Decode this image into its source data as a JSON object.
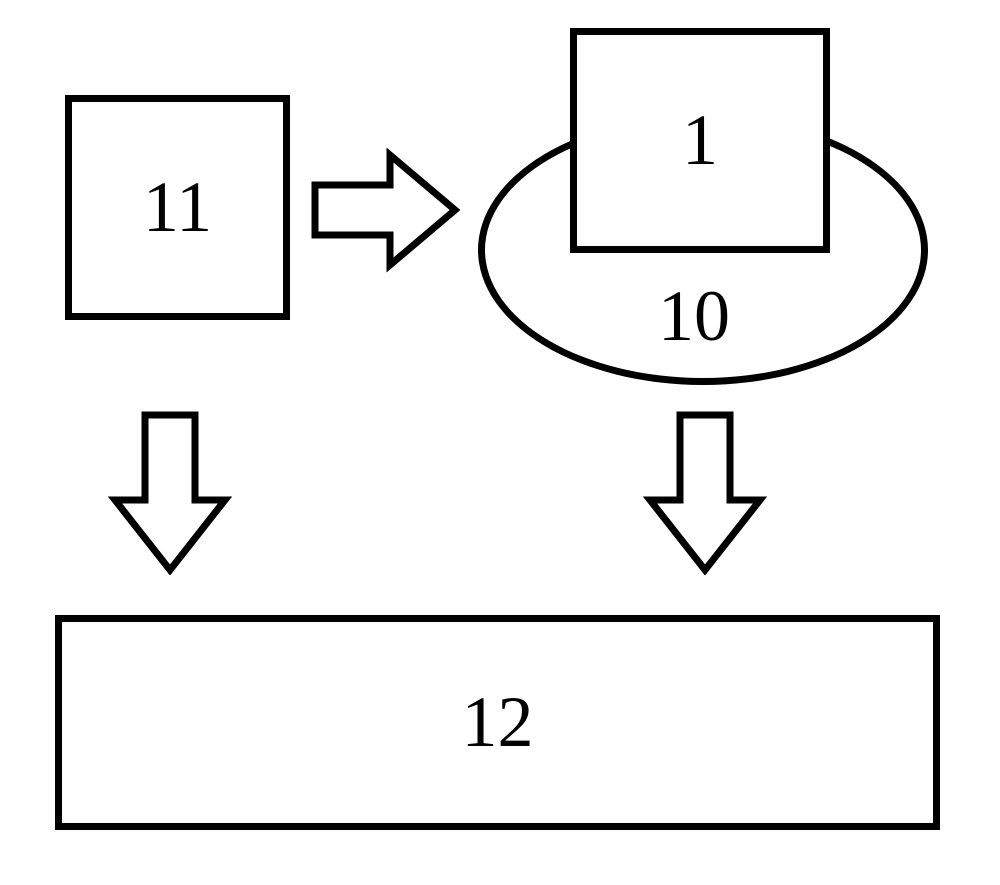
{
  "nodes": {
    "box11": {
      "label": "11"
    },
    "box1": {
      "label": "1"
    },
    "ellipse10": {
      "label": "10"
    },
    "box12": {
      "label": "12"
    }
  },
  "arrows": {
    "right": {
      "from": "11",
      "to": "10"
    },
    "down_left": {
      "from": "11",
      "to": "12"
    },
    "down_right": {
      "from": "10",
      "to": "12"
    }
  }
}
